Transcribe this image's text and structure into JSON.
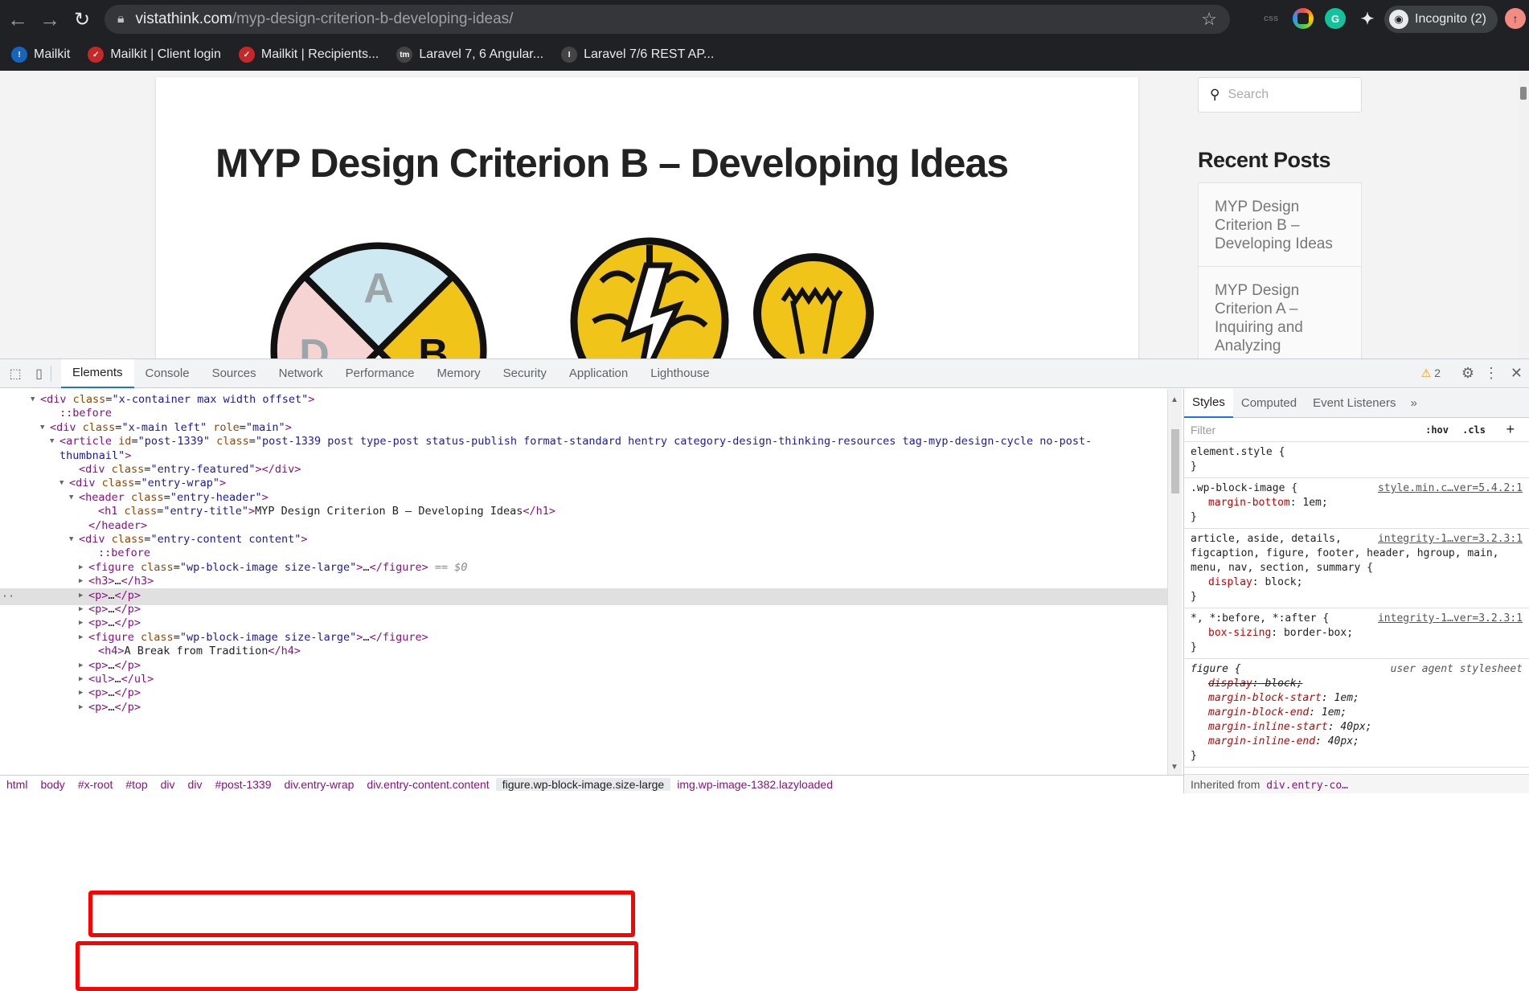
{
  "browser": {
    "url_host": "vistathink.com",
    "url_path": "/myp-design-criterion-b-developing-ideas/",
    "incognito_label": "Incognito (2)",
    "bookmarks": [
      {
        "label": "Mailkit",
        "color": "#1565c0",
        "glyph": "!"
      },
      {
        "label": "Mailkit | Client login",
        "color": "#c62828",
        "glyph": "✓"
      },
      {
        "label": "Mailkit | Recipients...",
        "color": "#c62828",
        "glyph": "✓"
      },
      {
        "label": "Laravel 7, 6 Angular...",
        "color": "#444",
        "glyph": "tm"
      },
      {
        "label": "Laravel 7/6 REST AP...",
        "color": "#444",
        "glyph": "I"
      }
    ]
  },
  "page": {
    "title": "MYP Design Criterion B – Developing Ideas",
    "search_placeholder": "Search",
    "recent_posts_title": "Recent Posts",
    "recent_posts": [
      "MYP Design Criterion B – Developing Ideas",
      "MYP Design Criterion A – Inquiring and Analyzing"
    ],
    "wheel_letters": [
      "A",
      "B",
      "D"
    ]
  },
  "devtools": {
    "tabs": [
      "Elements",
      "Console",
      "Sources",
      "Network",
      "Performance",
      "Memory",
      "Security",
      "Application",
      "Lighthouse"
    ],
    "warning_count": "2",
    "dom_lines": [
      {
        "indent": 50,
        "arrow": "▼",
        "html": "<span class='tag'>&lt;div</span> <span class='attr'>class</span>=<span class='val'>\"x-container max width offset\"</span><span class='tag'>&gt;</span>"
      },
      {
        "indent": 74,
        "arrow": "",
        "html": "<span class='pseudo'>::before</span>"
      },
      {
        "indent": 62,
        "arrow": "▼",
        "html": "<span class='tag'>&lt;div</span> <span class='attr'>class</span>=<span class='val'>\"x-main left\"</span> <span class='attr'>role</span>=<span class='val'>\"main\"</span><span class='tag'>&gt;</span>"
      },
      {
        "indent": 74,
        "arrow": "▼",
        "html": "<span class='tag'>&lt;article</span> <span class='attr'>id</span>=<span class='val'>\"post-1339\"</span> <span class='attr'>class</span>=<span class='val'>\"post-1339 post type-post status-publish format-standard hentry category-design-thinking-resources tag-myp-design-cycle no-post-</span>"
      },
      {
        "indent": 74,
        "arrow": "",
        "html": "<span class='val'>thumbnail\"</span><span class='tag'>&gt;</span>"
      },
      {
        "indent": 98,
        "arrow": "",
        "html": "<span class='tag'>&lt;div</span> <span class='attr'>class</span>=<span class='val'>\"entry-featured\"</span><span class='tag'>&gt;&lt;/div&gt;</span>"
      },
      {
        "indent": 86,
        "arrow": "▼",
        "html": "<span class='tag'>&lt;div</span> <span class='attr'>class</span>=<span class='val'>\"entry-wrap\"</span><span class='tag'>&gt;</span>"
      },
      {
        "indent": 98,
        "arrow": "▼",
        "html": "<span class='tag'>&lt;header</span> <span class='attr'>class</span>=<span class='val'>\"entry-header\"</span><span class='tag'>&gt;</span>"
      },
      {
        "indent": 122,
        "arrow": "",
        "html": "<span class='tag'>&lt;h1</span> <span class='attr'>class</span>=<span class='val'>\"entry-title\"</span><span class='tag'>&gt;</span><span class='txt'>MYP Design Criterion B – Developing Ideas</span><span class='tag'>&lt;/h1&gt;</span>"
      },
      {
        "indent": 110,
        "arrow": "",
        "html": "<span class='tag'>&lt;/header&gt;</span>"
      },
      {
        "indent": 98,
        "arrow": "▼",
        "html": "<span class='tag'>&lt;div</span> <span class='attr'>class</span>=<span class='val'>\"entry-content content\"</span><span class='tag'>&gt;</span>"
      },
      {
        "indent": 122,
        "arrow": "",
        "html": "<span class='pseudo'>::before</span>"
      },
      {
        "indent": 110,
        "arrow": "▶",
        "html": "<span class='tag'>&lt;figure</span> <span class='attr'>class</span>=<span class='val'>\"wp-block-image size-large\"</span><span class='tag'>&gt;</span>…<span class='tag'>&lt;/figure&gt;</span> <span style='color:#888;font-style:italic'>== $0</span>"
      },
      {
        "indent": 110,
        "arrow": "▶",
        "html": "<span class='tag'>&lt;h3&gt;</span>…<span class='tag'>&lt;/h3&gt;</span>"
      },
      {
        "indent": 110,
        "arrow": "▶",
        "html": "<span class='tag'>&lt;p&gt;</span>…<span class='tag'>&lt;/p&gt;</span>"
      },
      {
        "indent": 110,
        "arrow": "▶",
        "html": "<span class='tag'>&lt;p&gt;</span>…<span class='tag'>&lt;/p&gt;</span>"
      },
      {
        "indent": 110,
        "arrow": "▶",
        "html": "<span class='tag'>&lt;p&gt;</span>…<span class='tag'>&lt;/p&gt;</span>"
      },
      {
        "indent": 110,
        "arrow": "▶",
        "html": "<span class='tag'>&lt;figure</span> <span class='attr'>class</span>=<span class='val'>\"wp-block-image size-large\"</span><span class='tag'>&gt;</span>…<span class='tag'>&lt;/figure&gt;</span>"
      },
      {
        "indent": 122,
        "arrow": "",
        "html": "<span class='tag'>&lt;h4&gt;</span><span class='txt'>A Break from Tradition</span><span class='tag'>&lt;/h4&gt;</span>"
      },
      {
        "indent": 110,
        "arrow": "▶",
        "html": "<span class='tag'>&lt;p&gt;</span>…<span class='tag'>&lt;/p&gt;</span>"
      },
      {
        "indent": 110,
        "arrow": "▶",
        "html": "<span class='tag'>&lt;ul&gt;</span>…<span class='tag'>&lt;/ul&gt;</span>"
      },
      {
        "indent": 110,
        "arrow": "▶",
        "html": "<span class='tag'>&lt;p&gt;</span>…<span class='tag'>&lt;/p&gt;</span>"
      },
      {
        "indent": 110,
        "arrow": "▶",
        "html": "<span class='tag'>&lt;p&gt;</span>…<span class='tag'>&lt;/p&gt;</span>"
      }
    ],
    "styles_tabs": [
      "Styles",
      "Computed",
      "Event Listeners"
    ],
    "filter_placeholder": "Filter",
    "hov_label": ":hov",
    "cls_label": ".cls",
    "rules": [
      {
        "selector": "element.style {",
        "source": "",
        "props": [],
        "close": "}"
      },
      {
        "selector": ".wp-block-image {",
        "source": "style.min.c…ver=5.4.2:1",
        "props": [
          [
            "margin-bottom",
            "1em;"
          ]
        ],
        "close": "}"
      },
      {
        "selector": "article, aside, details, figcaption, figure, footer, header, hgroup, main, menu, nav, section, summary {",
        "source": "integrity-1…ver=3.2.3:1",
        "props": [
          [
            "display",
            "block;"
          ]
        ],
        "close": "}"
      },
      {
        "selector": "*, *:before, *:after {",
        "source": "integrity-1…ver=3.2.3:1",
        "props": [
          [
            "box-sizing",
            "border-box;"
          ]
        ],
        "close": "}"
      },
      {
        "selector": "figure {",
        "source": "user agent stylesheet",
        "props": [
          [
            "display",
            "block;"
          ],
          [
            "margin-block-start",
            "1em;"
          ],
          [
            "margin-block-end",
            "1em;"
          ],
          [
            "margin-inline-start",
            "40px;"
          ],
          [
            "margin-inline-end",
            "40px;"
          ]
        ],
        "close": "}"
      }
    ],
    "inherited_label": "Inherited from",
    "inherited_from": "div.entry-co…",
    "breadcrumbs": [
      "html",
      "body",
      "#x-root",
      "#top",
      "div",
      "div",
      "#post-1339",
      "div.entry-wrap",
      "div.entry-content.content",
      "figure.wp-block-image.size-large",
      "img.wp-image-1382.lazyloaded"
    ],
    "active_breadcrumb": 9
  }
}
